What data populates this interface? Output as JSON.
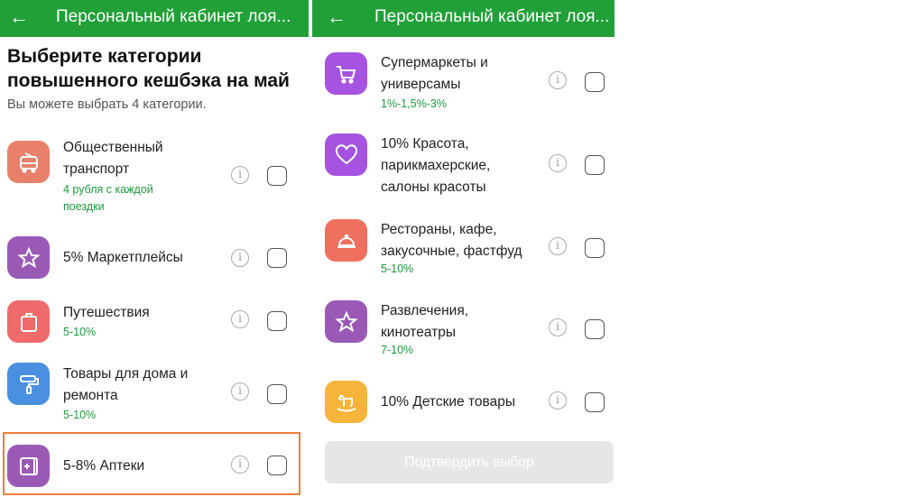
{
  "left": {
    "appbar": {
      "back_icon": "arrow-left-icon",
      "title": "Персональный кабинет лоя..."
    },
    "heading": "Выберите категории повышенного кешбэка на май",
    "subheading": "Вы можете выбрать 4 категории.",
    "categories": [
      {
        "icon": "bus-icon",
        "color": "#e8806b",
        "label_lines": [
          "Общественный",
          "транспорт"
        ],
        "sub_lines": [
          "4 рубля с каждой",
          "поездки"
        ]
      },
      {
        "icon": "star-icon",
        "color": "#9b59b6",
        "label_lines": [
          "5% Маркетплейсы"
        ],
        "sub_lines": []
      },
      {
        "icon": "suitcase-icon",
        "color": "#ef6b6b",
        "label_lines": [
          "Путешествия"
        ],
        "sub_lines": [
          "5-10%"
        ]
      },
      {
        "icon": "paint-roller-icon",
        "color": "#4a8fe0",
        "label_lines": [
          "Товары для дома и",
          "ремонта"
        ],
        "sub_lines": [
          "5-10%"
        ]
      },
      {
        "icon": "pharmacy-icon",
        "color": "#9b59b6",
        "label_lines": [
          "5-8% Аптеки"
        ],
        "sub_lines": []
      }
    ]
  },
  "right": {
    "appbar": {
      "back_icon": "arrow-left-icon",
      "title": "Персональный кабинет лоя..."
    },
    "categories": [
      {
        "icon": "cart-icon",
        "color": "#a553e0",
        "label_lines": [
          "Супермаркеты и",
          "универсамы"
        ],
        "sub_lines": [
          "1%-1,5%-3%"
        ]
      },
      {
        "icon": "heart-icon",
        "color": "#a553e0",
        "label_lines": [
          "10% Красота,",
          "парикмахерские,",
          "салоны красоты"
        ],
        "sub_lines": []
      },
      {
        "icon": "cloche-icon",
        "color": "#f07060",
        "label_lines": [
          "Рестораны, кафе,",
          "закусочные, фастфуд"
        ],
        "sub_lines": [
          "5-10%"
        ]
      },
      {
        "icon": "star-icon",
        "color": "#9b59b6",
        "label_lines": [
          "Развлечения,",
          "кинотеатры"
        ],
        "sub_lines": [
          "7-10%"
        ]
      },
      {
        "icon": "rocking-horse-icon",
        "color": "#f5b43a",
        "label_lines": [
          "10% Детские товары"
        ],
        "sub_lines": []
      }
    ],
    "confirm_button": "Подтвердить выбор"
  },
  "info_glyph": "i"
}
